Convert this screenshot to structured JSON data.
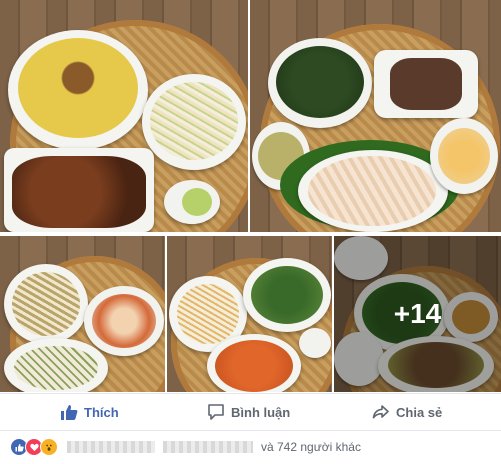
{
  "photos": {
    "more_count": "+14"
  },
  "actions": {
    "like_label": "Thích",
    "comment_label": "Bình luận",
    "share_label": "Chia sẻ"
  },
  "reactions": {
    "others_text": "và 742 người khác",
    "types": [
      "like-icon",
      "love-icon",
      "wow-icon"
    ]
  },
  "colors": {
    "like_blue": "#4267b2",
    "love_red": "#f33e58",
    "wow_yellow": "#f7b125"
  }
}
